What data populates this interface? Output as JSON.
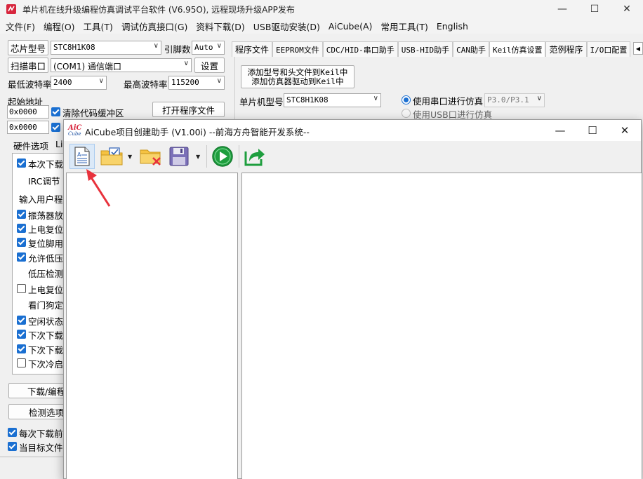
{
  "main_window": {
    "title": "单片机在线升级编程仿真调试平台软件 (V6.95O), 远程现场升级APP发布",
    "minimize": "—",
    "maximize": "☐",
    "close": "✕"
  },
  "menu": [
    "文件(F)",
    "编程(O)",
    "工具(T)",
    "调试仿真接口(G)",
    "资料下载(D)",
    "USB驱动安装(D)",
    "AiCube(A)",
    "常用工具(T)",
    "English"
  ],
  "left": {
    "chip_btn": "芯片型号",
    "chip_value": "STC8H1K08",
    "pins_label": "引脚数",
    "pins_value": "Auto",
    "scan_btn": "扫描串口",
    "port_value": "(COM1) 通信端口",
    "settings_btn": "设置",
    "min_baud_label": "最低波特率",
    "min_baud_value": "2400",
    "max_baud_label": "最高波特率",
    "max_baud_value": "115200",
    "start_addr_label": "起始地址",
    "addr1": "0x0000",
    "clear_buf_label": "清除代码缓冲区",
    "open_file_btn": "打开程序文件",
    "addr2": "0x0000",
    "tab_hw": "硬件选项",
    "tab_next": "Li",
    "hw_rows": [
      {
        "text": "本次下载",
        "check": "on"
      },
      {
        "text": "IRC调节",
        "check": "none"
      },
      {
        "text": "输入用户程",
        "check": "none"
      },
      {
        "text": "振荡器放",
        "check": "on"
      },
      {
        "text": "上电复位",
        "check": "on"
      },
      {
        "text": "复位脚用",
        "check": "on"
      },
      {
        "text": "允许低压",
        "check": "on"
      },
      {
        "text": "低压检测",
        "check": "none"
      },
      {
        "text": "上电复位",
        "check": "off"
      },
      {
        "text": "看门狗定",
        "check": "none"
      },
      {
        "text": "空闲状态",
        "check": "on"
      },
      {
        "text": "下次下载",
        "check": "on"
      },
      {
        "text": "下次下载",
        "check": "on"
      },
      {
        "text": "下次冷启",
        "check": "off"
      }
    ],
    "download_btn": "下载/编程",
    "check_btn": "检测选项",
    "bottom1": "每次下载前都",
    "bottom2": "当目标文件变"
  },
  "right": {
    "tabs": [
      "程序文件",
      "EEPROM文件",
      "CDC/HID-串口助手",
      "USB-HID助手",
      "CAN助手",
      "Keil仿真设置",
      "范例程序",
      "I/O口配置"
    ],
    "add_btn_line1": "添加型号和头文件到Keil中",
    "add_btn_line2": "添加仿真器驱动到Keil中",
    "mcu_label": "单片机型号",
    "mcu_value": "STC8H1K08",
    "radio1": "使用串口进行仿真",
    "radio1_port": "P3.0/P3.1",
    "radio2": "使用USB口进行仿真"
  },
  "dialog": {
    "logo_text_top": "AiC",
    "logo_text_bottom": "Cube",
    "title": "AiCube项目创建助手 (V1.00i) --前海方舟智能开发系统--",
    "toolbar_icons": [
      "new-document-icon",
      "open-folder-icon",
      "delete-folder-icon",
      "save-icon",
      "run-icon",
      "export-icon"
    ],
    "accent_red": "#e8323c",
    "accent_green": "#1e9e3e"
  }
}
